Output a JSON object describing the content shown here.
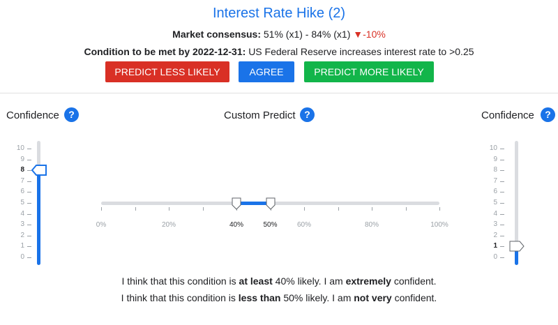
{
  "header": {
    "title": "Interest Rate Hike (2)",
    "consensus_label": "Market consensus:",
    "consensus_value": "51% (x1) - 84% (x1)",
    "consensus_delta": "▼-10%",
    "condition_label": "Condition to be met by 2022-12-31:",
    "condition_text": "US Federal Reserve increases interest rate to >0.25"
  },
  "buttons": {
    "less": "PREDICT LESS LIKELY",
    "agree": "AGREE",
    "more": "PREDICT MORE LIKELY"
  },
  "left_panel": {
    "label": "Confidence",
    "help": "?",
    "ticks": [
      "10",
      "9",
      "8",
      "7",
      "6",
      "5",
      "4",
      "3",
      "2",
      "1",
      "0"
    ],
    "value": 8
  },
  "center_panel": {
    "label": "Custom Predict",
    "help": "?",
    "ticks": [
      "0%",
      "20%",
      "40%",
      "50%",
      "60%",
      "80%",
      "100%"
    ],
    "range_low": 40,
    "range_high": 50
  },
  "right_panel": {
    "label": "Confidence",
    "help": "?",
    "ticks": [
      "10",
      "9",
      "8",
      "7",
      "6",
      "5",
      "4",
      "3",
      "2",
      "1",
      "0"
    ],
    "value": 1
  },
  "sentences": {
    "s1_pre": "I think that this condition is",
    "s1_bound": "at least",
    "s1_mid": "40% likely. I am",
    "s1_conf": "extremely",
    "s1_post": "confident.",
    "s2_pre": "I think that this condition is",
    "s2_bound": "less than",
    "s2_mid": "50% likely. I am",
    "s2_conf": "not very",
    "s2_post": "confident."
  },
  "colors": {
    "accent": "#1a73e8",
    "negative": "#d93025",
    "positive": "#12b54a"
  }
}
